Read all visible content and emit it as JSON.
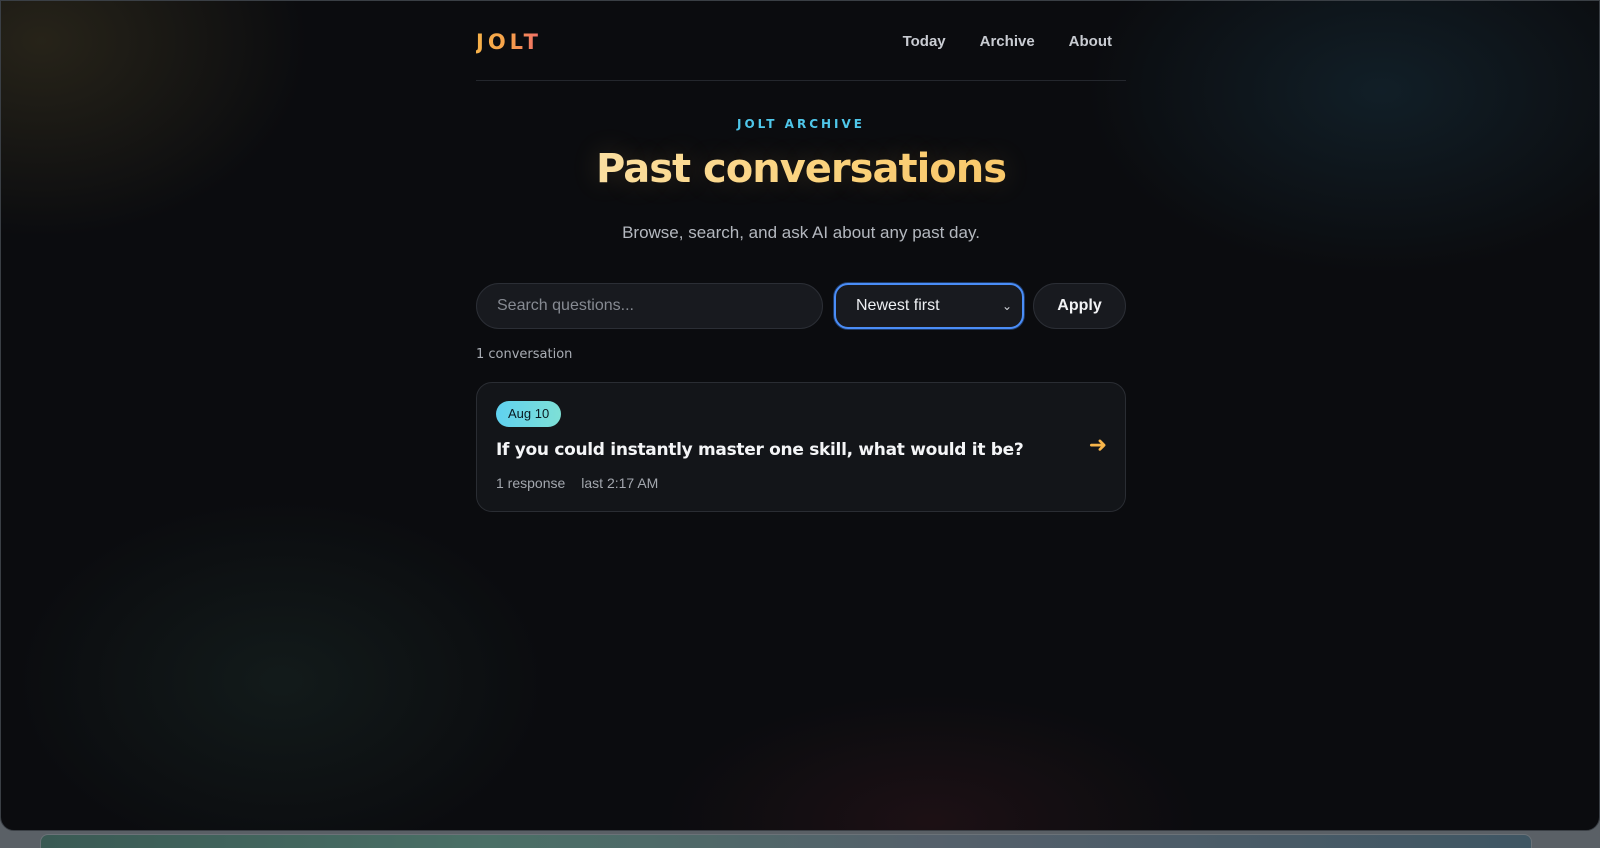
{
  "brand": {
    "logo": "JOLT"
  },
  "nav": {
    "items": [
      {
        "label": "Today"
      },
      {
        "label": "Archive"
      },
      {
        "label": "About"
      }
    ]
  },
  "hero": {
    "eyebrow": "JOLT ARCHIVE",
    "title": "Past conversations",
    "subtitle": "Browse, search, and ask AI about any past day."
  },
  "controls": {
    "search_placeholder": "Search questions...",
    "search_value": "",
    "sort_selected": "Newest first",
    "apply_label": "Apply"
  },
  "results": {
    "count_label": "1 conversation",
    "items": [
      {
        "date": "Aug 10",
        "question": "If you could instantly master one skill, what would it be?",
        "responses": "1 response",
        "last": "last 2:17 AM"
      }
    ]
  },
  "icons": {
    "chevron": "chevron-down-icon",
    "arrow": "arrow-right-icon"
  },
  "colors": {
    "accent_blue": "#4fc7ea",
    "accent_gold": "#f7b54a",
    "focus_ring": "#4a8df7"
  }
}
